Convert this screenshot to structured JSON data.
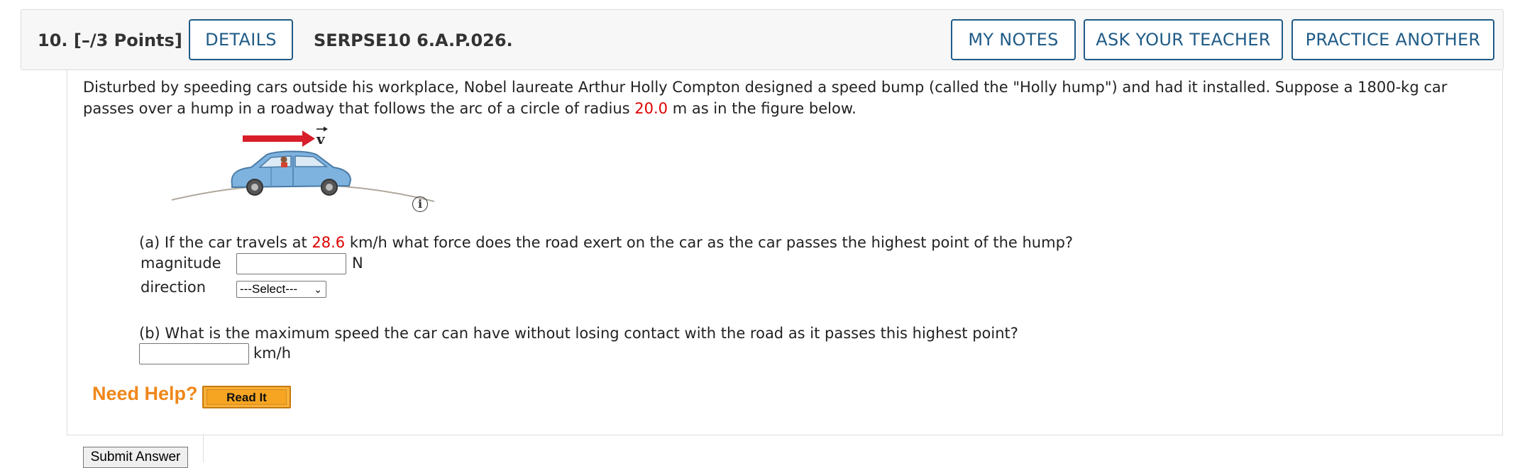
{
  "header": {
    "question_number": "10.",
    "points": "[–/3 Points]",
    "details_label": "DETAILS",
    "problem_code": "SERPSE10 6.A.P.026.",
    "my_notes_label": "MY NOTES",
    "ask_teacher_label": "ASK YOUR TEACHER",
    "practice_another_label": "PRACTICE ANOTHER"
  },
  "problem": {
    "intro_part1": "Disturbed by speeding cars outside his workplace, Nobel laureate Arthur Holly Compton designed a speed bump (called the \"Holly hump\") and had it installed. Suppose a 1800-kg car passes over a hump in a roadway that follows the arc of a circle of radius ",
    "radius": "20.0",
    "intro_part2": " m as in the figure below.",
    "figure_vector_label": "v",
    "info_icon": "i"
  },
  "part_a": {
    "question_part1": "(a) If the car travels at ",
    "speed": "28.6",
    "question_part2": " km/h what force does the road exert on the car as the car passes the highest point of the hump?",
    "magnitude_label": "magnitude",
    "magnitude_value": "",
    "magnitude_unit": "N",
    "direction_label": "direction",
    "direction_selected": "---Select---"
  },
  "part_b": {
    "question": "(b) What is the maximum speed the car can have without losing contact with the road as it passes this highest point?",
    "value": "",
    "unit": "km/h"
  },
  "help": {
    "need_help_label": "Need Help?",
    "read_it_label": "Read It"
  },
  "submit_label": "Submit Answer",
  "colors": {
    "button_border": "#1f5b87",
    "highlight": "#dd0000",
    "need_help": "#f0871a",
    "read_it_bg": "#f6a523",
    "car_body": "#7fb3df",
    "vector_arrow": "#d81e2a"
  }
}
